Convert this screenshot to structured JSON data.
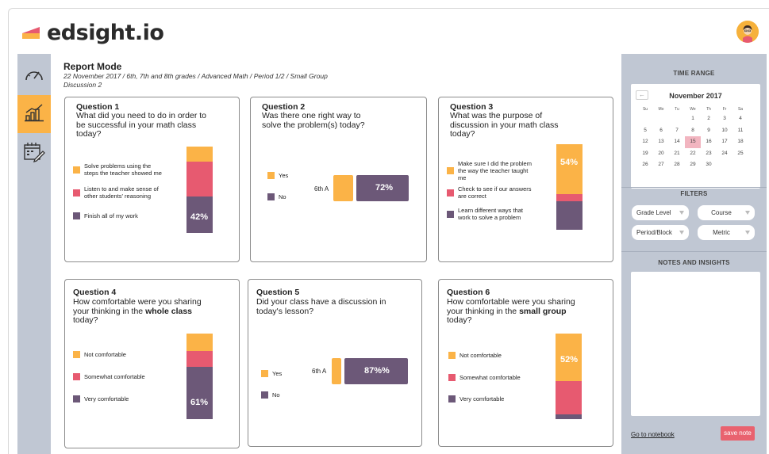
{
  "app": {
    "brand": "edsight.io"
  },
  "colors": {
    "orange": "#fbb347",
    "pink": "#e75a70",
    "purple": "#6c5878",
    "rail": "#c0c7d3"
  },
  "report": {
    "title": "Report Mode",
    "breadcrumb_line1": "22 November 2017 / 6th, 7th and 8th grades / Advanced Math / Period 1/2 / Small Group",
    "breadcrumb_line2": "Discussion 2"
  },
  "questions": [
    {
      "num": "Question 1",
      "lines": [
        "What did you need to do in order to",
        "be successful in your math class",
        "today?"
      ],
      "legend": [
        "Solve problems using the steps the teacher showed me",
        "Listen to and make sense of other students' reasoning",
        "Finish all of my work"
      ],
      "stack": [
        0.17,
        0.41,
        0.42
      ],
      "label": "42%"
    },
    {
      "num": "Question 2",
      "lines": [
        "Was there one right way to",
        "solve the problem(s) today?"
      ],
      "legend": [
        "Yes",
        "No"
      ],
      "category": "6th A",
      "stack": [
        0.28,
        0.72
      ],
      "label": "72%"
    },
    {
      "num": "Question 3",
      "lines": [
        "What was the purpose of",
        "discussion in your math class",
        "today?"
      ],
      "legend": [
        "Make sure I did the problem the way the teacher taught me",
        "Check to see if our answers are correct",
        "Learn different ways that work to solve a problem"
      ],
      "stack": [
        0.58,
        0.09,
        0.33
      ],
      "label": "54%"
    },
    {
      "num": "Question 4",
      "line1_pre": "How comfortable were you sharing",
      "line2_pre": "your thinking in the ",
      "line2_bold": "whole class",
      "line3": "today?",
      "legend": [
        "Not comfortable",
        "Somewhat comfortable",
        "Very comfortable"
      ],
      "stack": [
        0.2,
        0.19,
        0.61
      ],
      "label": "61%"
    },
    {
      "num": "Question 5",
      "lines": [
        "Did your class have a discussion in",
        "today's lesson?"
      ],
      "legend": [
        "Yes",
        "No"
      ],
      "category": "6th A",
      "stack": [
        0.13,
        0.87
      ],
      "label": "87%%"
    },
    {
      "num": "Question 6",
      "line1_pre": "How comfortable were you sharing",
      "line2_pre": "your thinking in the ",
      "line2_bold": "small group",
      "line3": "today?",
      "legend": [
        "Not comfortable",
        "Somewhat comfortable",
        "Very comfortable"
      ],
      "stack": [
        0.56,
        0.38,
        0.06
      ],
      "label": "52%"
    }
  ],
  "panel": {
    "time_range": "TIME RANGE",
    "calendar": {
      "prev": "←",
      "month": "November 2017",
      "weekdays": [
        "Su",
        "Mo",
        "Tu",
        "We",
        "Th",
        "Fr",
        "Sa"
      ],
      "weeks": [
        [
          "",
          "",
          "",
          "1",
          "2",
          "3",
          "4"
        ],
        [
          "5",
          "6",
          "7",
          "8",
          "9",
          "10",
          "11"
        ],
        [
          "12",
          "13",
          "14",
          "15",
          "16",
          "17",
          "18"
        ],
        [
          "19",
          "20",
          "21",
          "22",
          "23",
          "24",
          "25"
        ],
        [
          "26",
          "27",
          "28",
          "29",
          "30",
          "",
          ""
        ]
      ],
      "selected": "15"
    },
    "filters_title": "FILTERS",
    "filters": [
      "Grade Level",
      "Course",
      "Period/Block",
      "Metric"
    ],
    "notes_title": "NOTES AND INSIGHTS",
    "goto": "Go to notebook",
    "save": "save note"
  }
}
